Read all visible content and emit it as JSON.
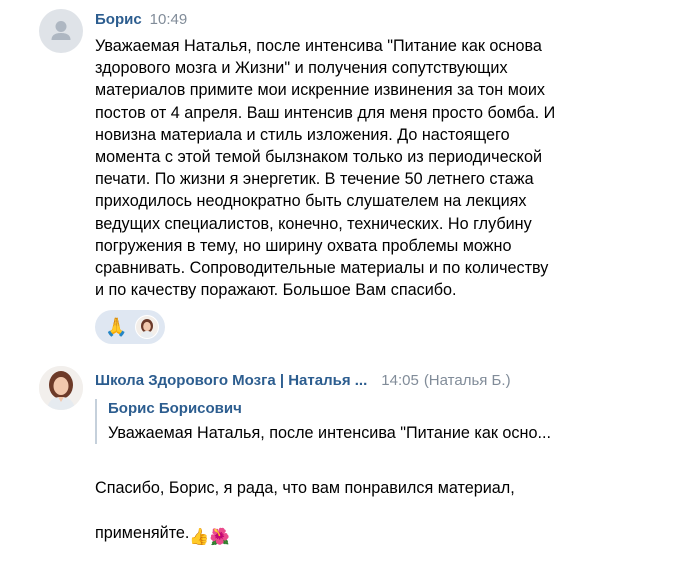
{
  "messages": [
    {
      "author": "Борис",
      "time": "10:49",
      "text": "Уважаемая Наталья, после интенсива \"Питание как основа\nздорового мозга и Жизни\" и получения сопутствующих\nматериалов примите мои искренние извинения за тон моих\nпостов от 4 апреля. Ваш интенсив для меня просто бомба. И\nновизна материала и стиль изложения. До настоящего\nмомента с этой темой былзнаком только из периодической\nпечати. По жизни я энергетик. В течение 50 летнего стажа\nприходилось неоднократно быть слушателем на лекциях\nведущих специалистов, конечно, технических. Но глубину\nпогружения в тему, но ширину охвата проблемы можно\nсравнивать. Сопроводительные материалы и по количеству\nи по качеству поражают. Большое Вам спасибо.",
      "reaction_emoji": "🙏",
      "avatar_icon": "default-user-avatar"
    },
    {
      "author": "Школа Здорового Мозга | Наталья ...",
      "time": "14:05",
      "signature": "(Наталья Б.)",
      "reply_to": {
        "author": "Борис Борисович",
        "text": "Уважаемая Наталья, после интенсива \"Питание как осно..."
      },
      "text_line1": "Спасибо, Борис, я рада, что вам понравился материал,",
      "text_line2": "применяйте.",
      "emojis": [
        "👍",
        "🌺"
      ],
      "avatar_icon": "woman-portrait-avatar"
    }
  ],
  "colors": {
    "author": "#2c5d8f",
    "time": "#818c99",
    "reaction_bg": "#dfe7f2",
    "quote_border": "#c5d0db"
  }
}
